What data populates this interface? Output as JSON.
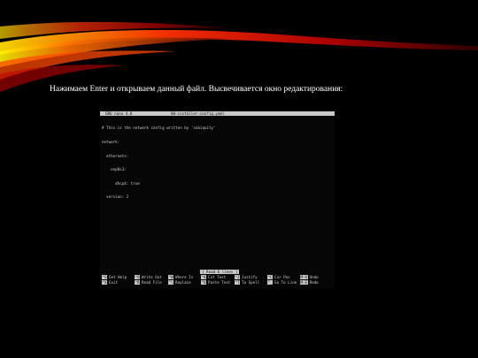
{
  "caption": "Нажимаем Enter и открываем данный файл. Высвечивается окно редактирования:",
  "colors": {
    "background": "#000000",
    "swoosh": [
      "#ffde00",
      "#ff8a00",
      "#ff2a00",
      "#a00000"
    ],
    "terminal_bar": "#c8c8c8"
  },
  "nano": {
    "version_label": "GNU nano 4.8",
    "filename": "00-installer-config.yaml",
    "lines": [
      "# This is the network config written by 'subiquity'",
      "network:",
      "  ethernets:",
      "    enp0s3:",
      "      dhcp4: true",
      "  version: 2"
    ],
    "status_message": "[ Read 6 lines ]",
    "shortcut_rows": [
      [
        {
          "key": "^G",
          "label": "Get Help"
        },
        {
          "key": "^O",
          "label": "Write Out"
        },
        {
          "key": "^W",
          "label": "Where Is"
        },
        {
          "key": "^K",
          "label": "Cut Text"
        },
        {
          "key": "^J",
          "label": "Justify"
        },
        {
          "key": "^C",
          "label": "Cur Pos"
        },
        {
          "key": "M-U",
          "label": "Undo"
        }
      ],
      [
        {
          "key": "^X",
          "label": "Exit"
        },
        {
          "key": "^R",
          "label": "Read File"
        },
        {
          "key": "^\\",
          "label": "Replace"
        },
        {
          "key": "^U",
          "label": "Paste Text"
        },
        {
          "key": "^T",
          "label": "To Spell"
        },
        {
          "key": "^_",
          "label": "Go To Line"
        },
        {
          "key": "M-E",
          "label": "Redo"
        }
      ]
    ]
  }
}
